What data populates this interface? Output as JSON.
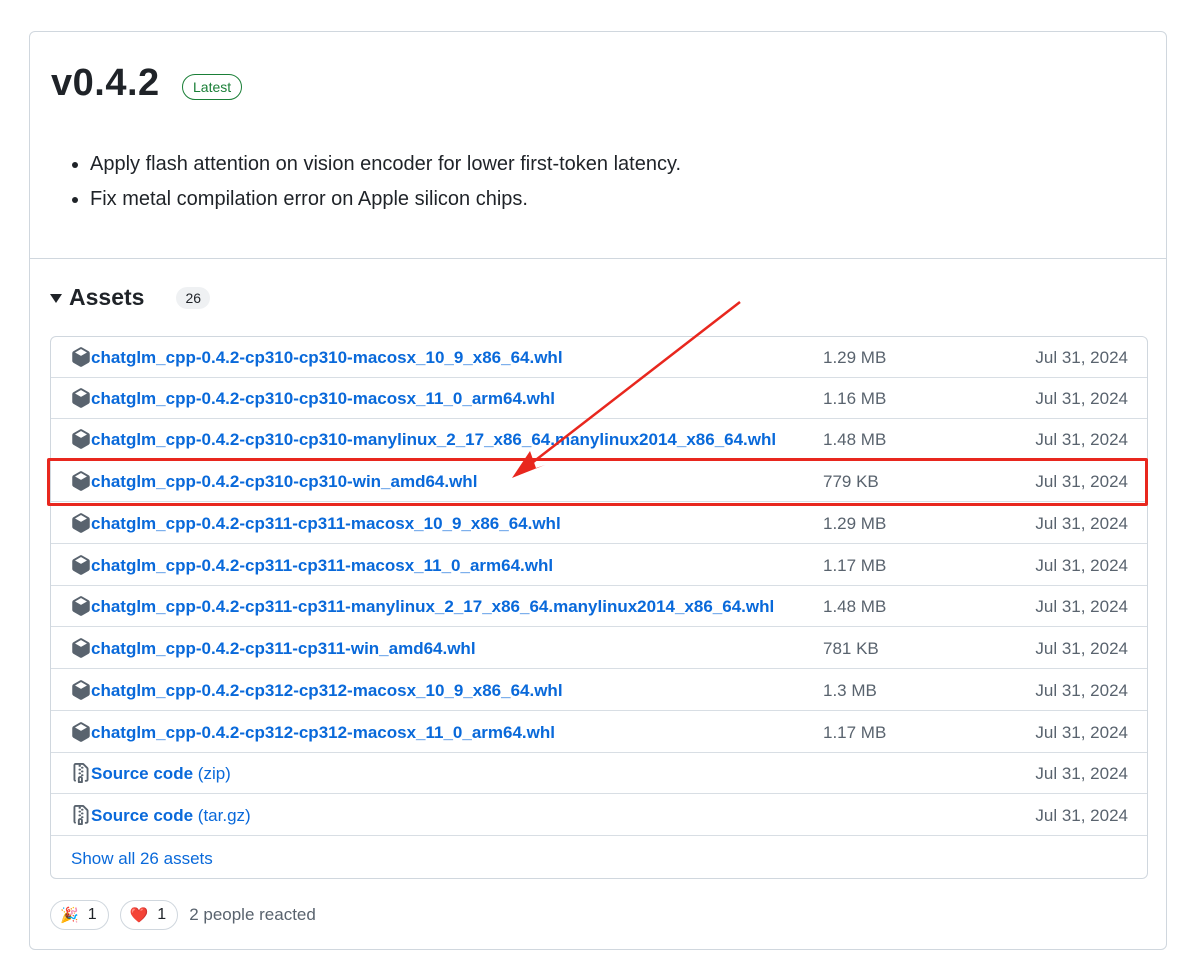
{
  "release": {
    "title": "v0.4.2",
    "badge": "Latest",
    "notes": [
      "Apply flash attention on vision encoder for lower first-token latency.",
      "Fix metal compilation error on Apple silicon chips."
    ]
  },
  "assets": {
    "title": "Assets",
    "count": "26",
    "rows": [
      {
        "name": "chatglm_cpp-0.4.2-cp310-cp310-macosx_10_9_x86_64.whl",
        "size": "1.29 MB",
        "date": "Jul 31, 2024",
        "icon": "package-icon"
      },
      {
        "name": "chatglm_cpp-0.4.2-cp310-cp310-macosx_11_0_arm64.whl",
        "size": "1.16 MB",
        "date": "Jul 31, 2024",
        "icon": "package-icon"
      },
      {
        "name": "chatglm_cpp-0.4.2-cp310-cp310-manylinux_2_17_x86_64.manylinux2014_x86_64.whl",
        "size": "1.48 MB",
        "date": "Jul 31, 2024",
        "icon": "package-icon"
      },
      {
        "name": "chatglm_cpp-0.4.2-cp310-cp310-win_amd64.whl",
        "size": "779 KB",
        "date": "Jul 31, 2024",
        "icon": "package-icon"
      },
      {
        "name": "chatglm_cpp-0.4.2-cp311-cp311-macosx_10_9_x86_64.whl",
        "size": "1.29 MB",
        "date": "Jul 31, 2024",
        "icon": "package-icon"
      },
      {
        "name": "chatglm_cpp-0.4.2-cp311-cp311-macosx_11_0_arm64.whl",
        "size": "1.17 MB",
        "date": "Jul 31, 2024",
        "icon": "package-icon"
      },
      {
        "name": "chatglm_cpp-0.4.2-cp311-cp311-manylinux_2_17_x86_64.manylinux2014_x86_64.whl",
        "size": "1.48 MB",
        "date": "Jul 31, 2024",
        "icon": "package-icon"
      },
      {
        "name": "chatglm_cpp-0.4.2-cp311-cp311-win_amd64.whl",
        "size": "781 KB",
        "date": "Jul 31, 2024",
        "icon": "package-icon"
      },
      {
        "name": "chatglm_cpp-0.4.2-cp312-cp312-macosx_10_9_x86_64.whl",
        "size": "1.3 MB",
        "date": "Jul 31, 2024",
        "icon": "package-icon"
      },
      {
        "name": "chatglm_cpp-0.4.2-cp312-cp312-macosx_11_0_arm64.whl",
        "size": "1.17 MB",
        "date": "Jul 31, 2024",
        "icon": "package-icon"
      },
      {
        "name": "Source code",
        "suffix": "(zip)",
        "size": "",
        "date": "Jul 31, 2024",
        "icon": "file-zip-icon"
      },
      {
        "name": "Source code",
        "suffix": "(tar.gz)",
        "size": "",
        "date": "Jul 31, 2024",
        "icon": "file-zip-icon"
      }
    ],
    "show_all": "Show all 26 assets"
  },
  "reactions": {
    "items": [
      {
        "emoji": "🎉",
        "count": "1",
        "icon": "party-popper-icon"
      },
      {
        "emoji": "❤️",
        "count": "1",
        "icon": "heart-icon"
      }
    ],
    "summary": "2 people reacted"
  },
  "annotation": {
    "color": "#e8271e",
    "highlighted_row": 3
  }
}
